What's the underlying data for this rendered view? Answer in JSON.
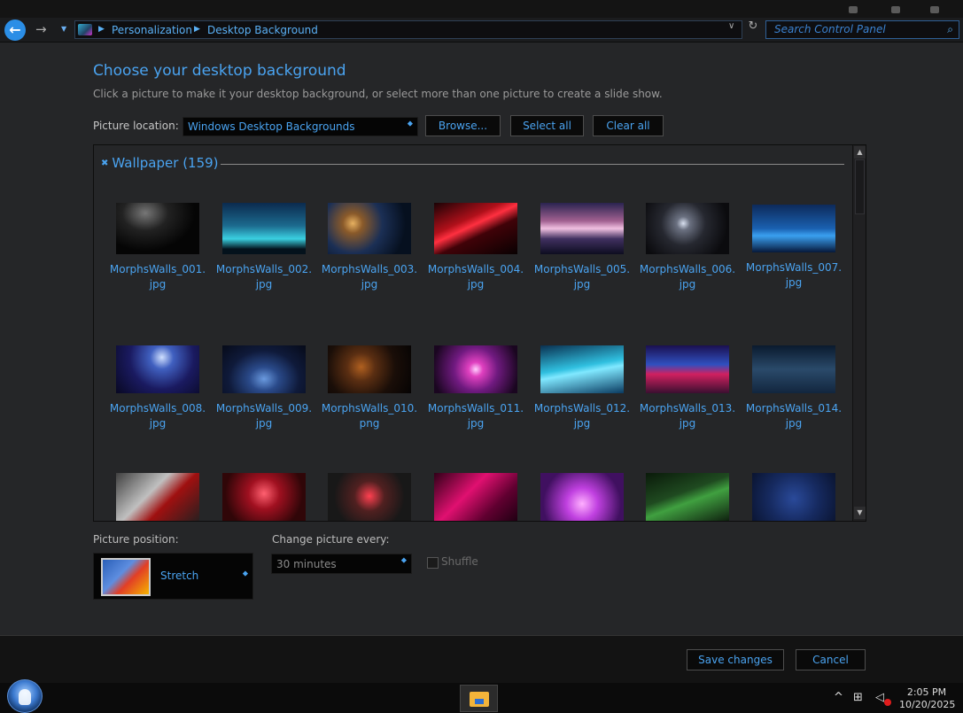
{
  "navigation": {
    "breadcrumbs": [
      "Personalization",
      "Desktop Background"
    ],
    "search_placeholder": "Search Control Panel"
  },
  "main": {
    "title": "Choose your desktop background",
    "description": "Click a picture to make it your desktop background, or select more than one picture to create a slide show.",
    "picture_location_label": "Picture location:",
    "picture_location_value": "Windows Desktop Backgrounds",
    "buttons": {
      "browse": "Browse...",
      "select_all": "Select all",
      "clear_all": "Clear all"
    }
  },
  "gallery": {
    "group_label": "Wallpaper (159)",
    "thumbnails": [
      {
        "name_line1": "MorphsWalls_001.",
        "name_line2": "jpg"
      },
      {
        "name_line1": "MorphsWalls_002.",
        "name_line2": "jpg"
      },
      {
        "name_line1": "MorphsWalls_003.",
        "name_line2": "jpg"
      },
      {
        "name_line1": "MorphsWalls_004.",
        "name_line2": "jpg"
      },
      {
        "name_line1": "MorphsWalls_005.",
        "name_line2": "jpg"
      },
      {
        "name_line1": "MorphsWalls_006.",
        "name_line2": "jpg"
      },
      {
        "name_line1": "MorphsWalls_007.",
        "name_line2": "jpg"
      },
      {
        "name_line1": "MorphsWalls_008.",
        "name_line2": "jpg"
      },
      {
        "name_line1": "MorphsWalls_009.",
        "name_line2": "jpg"
      },
      {
        "name_line1": "MorphsWalls_010.",
        "name_line2": "png"
      },
      {
        "name_line1": "MorphsWalls_011.",
        "name_line2": "jpg"
      },
      {
        "name_line1": "MorphsWalls_012.",
        "name_line2": "jpg"
      },
      {
        "name_line1": "MorphsWalls_013.",
        "name_line2": "jpg"
      },
      {
        "name_line1": "MorphsWalls_014.",
        "name_line2": "jpg"
      },
      {
        "name_line1": "",
        "name_line2": ""
      },
      {
        "name_line1": "",
        "name_line2": ""
      },
      {
        "name_line1": "",
        "name_line2": ""
      },
      {
        "name_line1": "",
        "name_line2": ""
      },
      {
        "name_line1": "",
        "name_line2": ""
      },
      {
        "name_line1": "",
        "name_line2": ""
      },
      {
        "name_line1": "",
        "name_line2": ""
      }
    ]
  },
  "options": {
    "position_label": "Picture position:",
    "position_value": "Stretch",
    "change_label": "Change picture every:",
    "change_value": "30 minutes",
    "shuffle_label": "Shuffle"
  },
  "footer": {
    "save": "Save changes",
    "cancel": "Cancel"
  },
  "taskbar": {
    "time": "2:05 PM",
    "date": "10/20/2025"
  },
  "colors": {
    "accent": "#4aa3f0",
    "background": "#252628",
    "taskbar": "#0b0b0b"
  }
}
